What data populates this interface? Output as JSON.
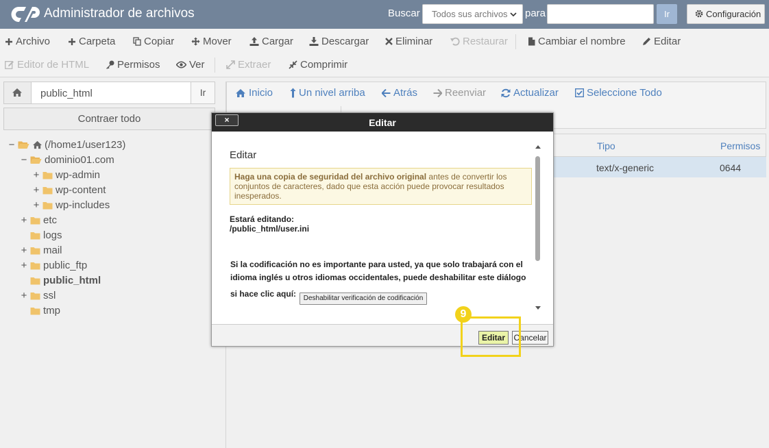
{
  "header": {
    "title": "Administrador de archivos",
    "search_label": "Buscar",
    "search_scope": "Todos sus archivos",
    "for_label": "para",
    "search_value": "",
    "go_label": "Ir",
    "config_label": "Configuración"
  },
  "toolbar": {
    "row1": [
      "Archivo",
      "Carpeta",
      "Copiar",
      "Mover",
      "Cargar",
      "Descargar",
      "Eliminar",
      "Restaurar",
      "Cambiar el nombre",
      "Editar"
    ],
    "row2": [
      "Editor de HTML",
      "Permisos",
      "Ver",
      "Extraer",
      "Comprimir"
    ]
  },
  "left_panel": {
    "path_value": "public_html",
    "go_label": "Ir",
    "collapse_label": "Contraer todo",
    "tree": [
      {
        "label": "(/home1/user123)",
        "sign": "−"
      },
      {
        "label": "dominio01.com",
        "sign": "−"
      },
      {
        "label": "wp-admin",
        "sign": "+"
      },
      {
        "label": "wp-content",
        "sign": "+"
      },
      {
        "label": "wp-includes",
        "sign": "+"
      },
      {
        "label": "etc",
        "sign": "+"
      },
      {
        "label": "logs",
        "sign": ""
      },
      {
        "label": "mail",
        "sign": "+"
      },
      {
        "label": "public_ftp",
        "sign": "+"
      },
      {
        "label": "public_html",
        "sign": ""
      },
      {
        "label": "ssl",
        "sign": "+"
      },
      {
        "label": "tmp",
        "sign": ""
      }
    ]
  },
  "nav": {
    "home": "Inicio",
    "up": "Un nivel arriba",
    "back": "Atrás",
    "forward": "Reenviar",
    "refresh": "Actualizar",
    "select_all": "Seleccione Todo"
  },
  "table": {
    "headers": {
      "type": "Tipo",
      "perms": "Permisos"
    },
    "row": {
      "type": "text/x-generic",
      "perms": "0644"
    }
  },
  "dialog": {
    "title": "Editar",
    "close": "×",
    "heading": "Editar",
    "warning_bold": "Haga una copia de seguridad del archivo original",
    "warning_rest": " antes de convertir los conjuntos de caracteres, dado que esta acción puede provocar resultados inesperados.",
    "editing_label": "Estará editando:",
    "editing_path": "/public_html/user.ini",
    "note_line1": "Si la codificación no es importante para usted, ya que solo trabajará con el",
    "note_line2": "idioma inglés u otros idiomas occidentales, puede deshabilitar este diálogo",
    "note_line3": "si hace clic aquí:",
    "disable_button": "Deshabilitar verificación de codificación",
    "edit_button": "Editar",
    "cancel_button": "Cancelar"
  },
  "tutorial": {
    "step": "9",
    "highlight_color": "#f2d21b"
  },
  "colors": {
    "header": "#72849a",
    "link": "#4e80bd",
    "folder": "#f0c36a",
    "selected_row": "#d7e4f0"
  }
}
